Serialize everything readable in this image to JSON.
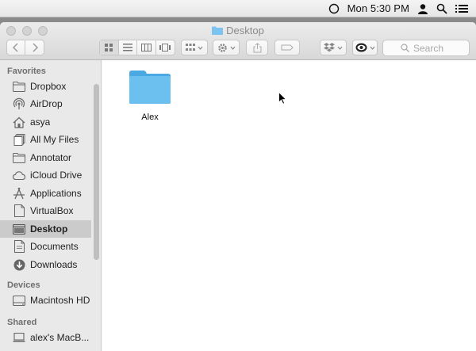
{
  "menubar": {
    "clock": "Mon 5:30 PM",
    "icons": [
      "status-circle-icon",
      "user-icon",
      "spotlight-search-icon",
      "notification-list-icon"
    ]
  },
  "window": {
    "title": "Desktop",
    "traffic_lights": [
      "close",
      "minimize",
      "zoom"
    ]
  },
  "toolbar": {
    "search_placeholder": "Search",
    "buttons": [
      "back",
      "forward",
      "icon-view",
      "list-view",
      "column-view",
      "cover-flow-view",
      "arrange",
      "action-gear",
      "share",
      "tags",
      "dropbox",
      "eye-preview"
    ]
  },
  "sidebar": {
    "favorites_heading": "Favorites",
    "devices_heading": "Devices",
    "shared_heading": "Shared",
    "favorites": [
      {
        "label": "Dropbox",
        "icon": "folder-icon"
      },
      {
        "label": "AirDrop",
        "icon": "airdrop-icon"
      },
      {
        "label": "asya",
        "icon": "home-icon"
      },
      {
        "label": "All My Files",
        "icon": "all-files-icon"
      },
      {
        "label": "Annotator",
        "icon": "folder-icon"
      },
      {
        "label": "iCloud Drive",
        "icon": "cloud-icon"
      },
      {
        "label": "Applications",
        "icon": "applications-icon"
      },
      {
        "label": "VirtualBox",
        "icon": "document-icon"
      },
      {
        "label": "Desktop",
        "icon": "desktop-icon",
        "selected": true
      },
      {
        "label": "Documents",
        "icon": "document-icon"
      },
      {
        "label": "Downloads",
        "icon": "download-icon"
      }
    ],
    "devices": [
      {
        "label": "Macintosh HD",
        "icon": "hard-drive-icon"
      }
    ],
    "shared": [
      {
        "label": "alex's MacB...",
        "icon": "laptop-icon"
      }
    ]
  },
  "content": {
    "files": [
      {
        "name": "Alex",
        "kind": "folder",
        "color": "#5fb8ec"
      }
    ]
  },
  "colors": {
    "folder_blue": "#5fb8ec",
    "selection_gray": "#cbcbcb"
  }
}
